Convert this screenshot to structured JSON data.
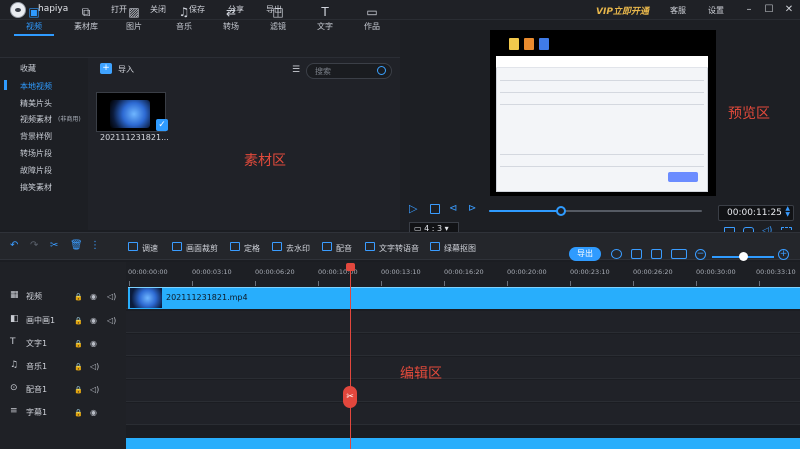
{
  "titlebar": {
    "username": "hapiya",
    "menu": [
      "打开",
      "关闭",
      "保存",
      "分享",
      "导出"
    ],
    "vip": "VIP立即开通",
    "kefu": "客服",
    "settings": "设置",
    "window_controls": [
      "minimize-icon",
      "maximize-icon",
      "close-icon"
    ]
  },
  "media_tabs": [
    {
      "label": "视频",
      "icon": "film-icon",
      "active": true
    },
    {
      "label": "素材库",
      "icon": "library-icon",
      "active": false
    },
    {
      "label": "图片",
      "icon": "image-icon",
      "active": false
    },
    {
      "label": "音乐",
      "icon": "music-icon",
      "active": false
    },
    {
      "label": "转场",
      "icon": "transition-icon",
      "active": false
    },
    {
      "label": "滤镜",
      "icon": "filter-icon",
      "active": false
    },
    {
      "label": "文字",
      "icon": "text-icon",
      "active": false
    },
    {
      "label": "作品",
      "icon": "folder-icon",
      "active": false
    }
  ],
  "categories": [
    "收藏",
    "本地视频",
    "精美片头",
    "视频素材",
    "背景样例",
    "转场片段",
    "故障片段",
    "搞笑素材"
  ],
  "category_badge": "(非商用)",
  "media": {
    "import_label": "导入",
    "search_placeholder": "搜索",
    "clip_name": "202111231821...",
    "zone_label": "素材区"
  },
  "preview": {
    "zone_label": "预览区",
    "timecode": "00:00:11:25",
    "progress": 0.34,
    "ratio": "4 : 3",
    "ratio_icon": "monitor-icon"
  },
  "toolbar": {
    "tools": [
      {
        "label": "调速",
        "icon": "speed-icon"
      },
      {
        "label": "画面裁剪",
        "icon": "crop-icon"
      },
      {
        "label": "定格",
        "icon": "freeze-icon"
      },
      {
        "label": "去水印",
        "icon": "watermark-icon"
      },
      {
        "label": "配音",
        "icon": "mic-icon"
      },
      {
        "label": "文字转语音",
        "icon": "tts-icon"
      },
      {
        "label": "绿幕抠图",
        "icon": "greenscreen-icon"
      }
    ],
    "export_label": "导出",
    "zoom": 0.5
  },
  "timeline": {
    "ticks": [
      "00:00:00:00",
      "00:00:03:10",
      "00:00:06:20",
      "00:00:10:00",
      "00:00:13:10",
      "00:00:16:20",
      "00:00:20:00",
      "00:00:23:10",
      "00:00:26:20",
      "00:00:30:00",
      "00:00:33:10"
    ],
    "tracks": [
      {
        "name": "视频",
        "icon": "video-track-icon",
        "lock": true,
        "eye": true,
        "vol": true
      },
      {
        "name": "画中画1",
        "icon": "pip-track-icon",
        "lock": true,
        "eye": true,
        "vol": true
      },
      {
        "name": "文字1",
        "icon": "text-track-icon",
        "lock": true,
        "eye": true,
        "vol": false
      },
      {
        "name": "音乐1",
        "icon": "music-track-icon",
        "lock": true,
        "eye": false,
        "vol": true
      },
      {
        "name": "配音1",
        "icon": "mic-track-icon",
        "lock": true,
        "eye": false,
        "vol": true
      },
      {
        "name": "字幕1",
        "icon": "subtitle-track-icon",
        "lock": true,
        "eye": true,
        "vol": false
      }
    ],
    "clip_name": "202111231821.mp4",
    "zone_label": "编辑区"
  }
}
